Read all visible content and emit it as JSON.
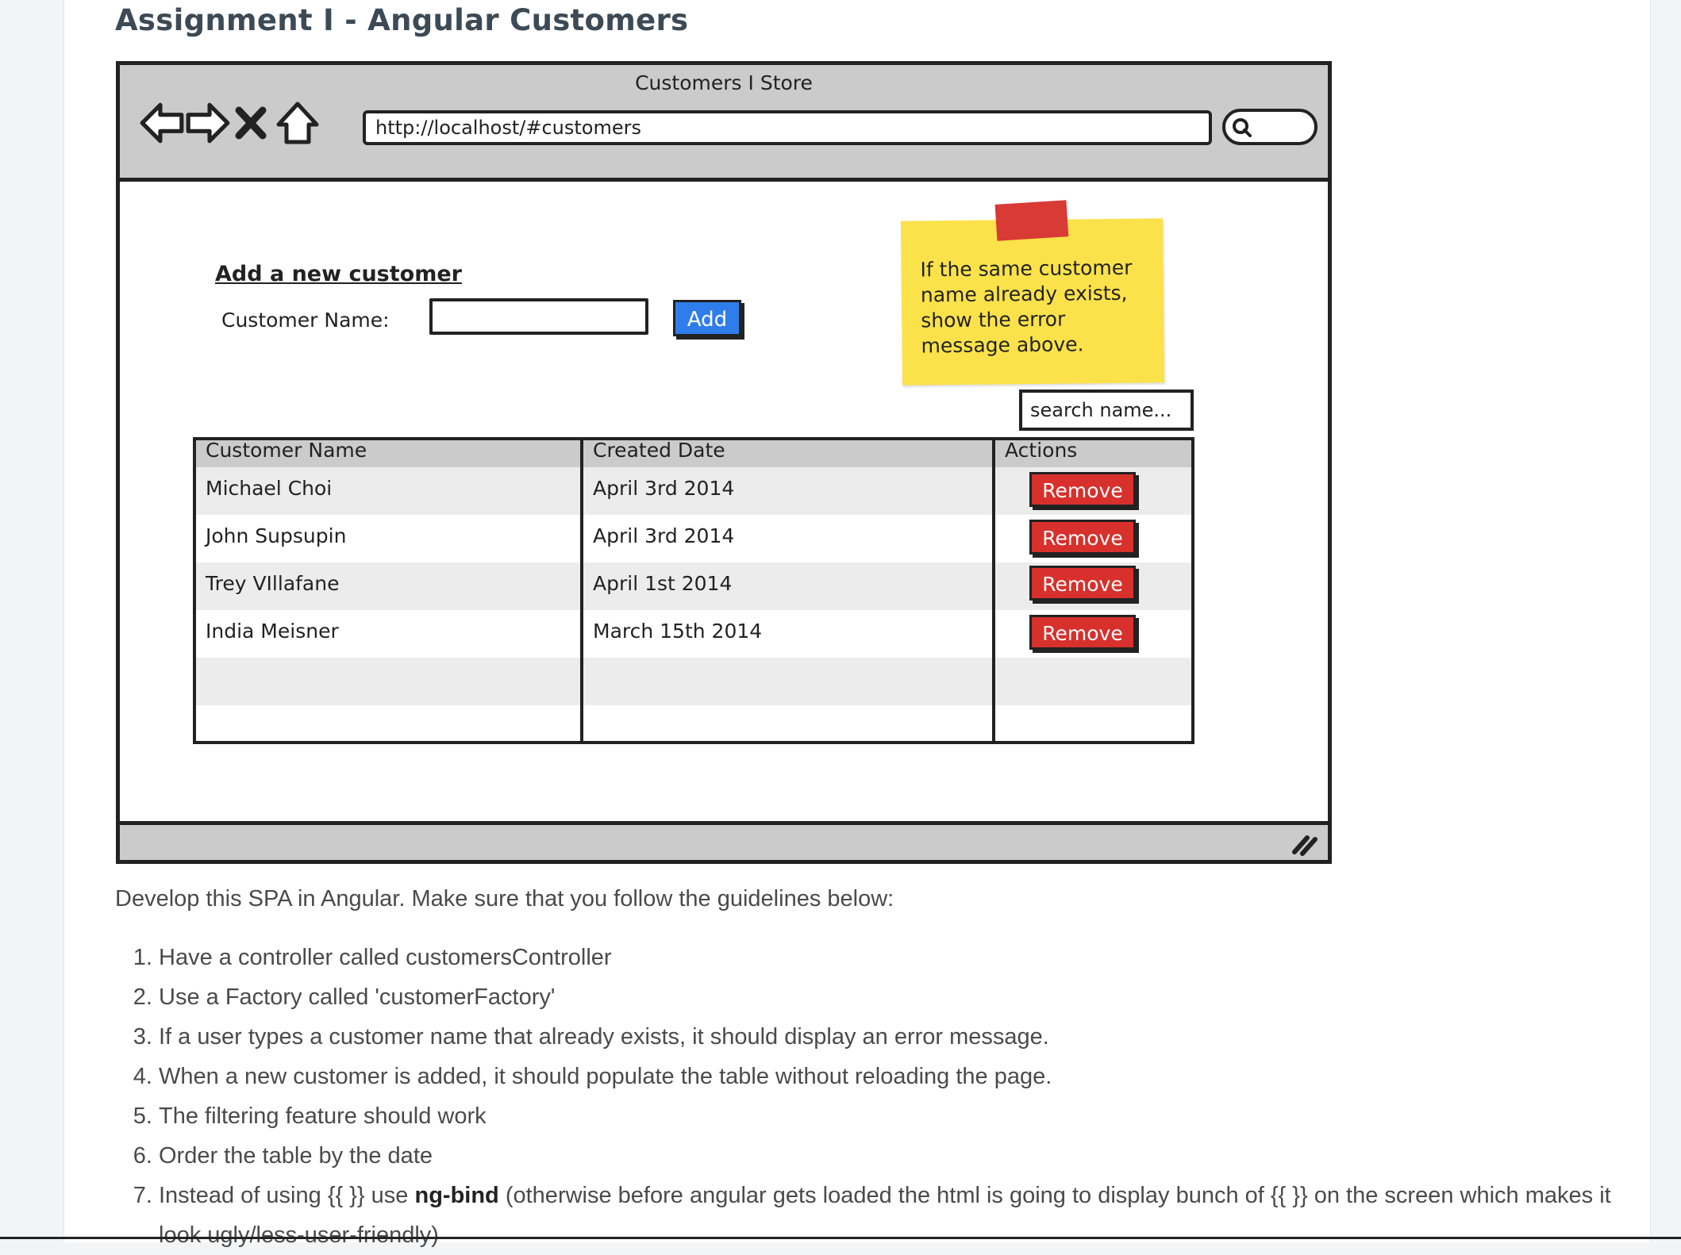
{
  "page": {
    "title": "Assignment I - Angular Customers"
  },
  "mockup": {
    "window_title": "Customers I Store",
    "url": "http://localhost/#customers",
    "form": {
      "heading": "Add a new customer",
      "name_label": "Customer Name:",
      "name_value": "",
      "add_label": "Add"
    },
    "note": "If the same customer name already exists, show the error message above.",
    "filter_placeholder": "search name...",
    "table": {
      "headers": [
        "Customer Name",
        "Created Date",
        "Actions"
      ],
      "rows": [
        {
          "name": "Michael Choi",
          "date": "April 3rd 2014",
          "action": "Remove"
        },
        {
          "name": "John Supsupin",
          "date": "April 3rd 2014",
          "action": "Remove"
        },
        {
          "name": "Trey VIllafane",
          "date": "April 1st 2014",
          "action": "Remove"
        },
        {
          "name": "India Meisner",
          "date": "March 15th 2014",
          "action": "Remove"
        }
      ]
    },
    "icons": [
      "back-arrow-icon",
      "forward-arrow-icon",
      "close-icon",
      "home-icon",
      "search-icon",
      "resize-grip-icon"
    ]
  },
  "instructions": {
    "intro": "Develop this SPA in Angular.  Make sure that you follow the guidelines below:",
    "steps": [
      "Have a controller called customersController",
      "Use a Factory called 'customerFactory'",
      "If a user types a customer name that already exists, it should display an error message.",
      "When a new customer is added, it should populate the table without reloading the page.",
      "The filtering feature should work",
      "Order the table by the date"
    ],
    "step7": {
      "before": "Instead of using {{ }} use ",
      "bold": "ng-bind",
      "after": " (otherwise before angular gets loaded the html is going to display bunch of {{ }} on the screen which makes it look ugly/less-user-friendly)"
    }
  },
  "colors": {
    "add_button": "#2f7dea",
    "remove_button": "#d8302c",
    "sticky_note": "#fbe24a",
    "tape": "#d83a35",
    "wire_gray": "#cbcbcb"
  }
}
